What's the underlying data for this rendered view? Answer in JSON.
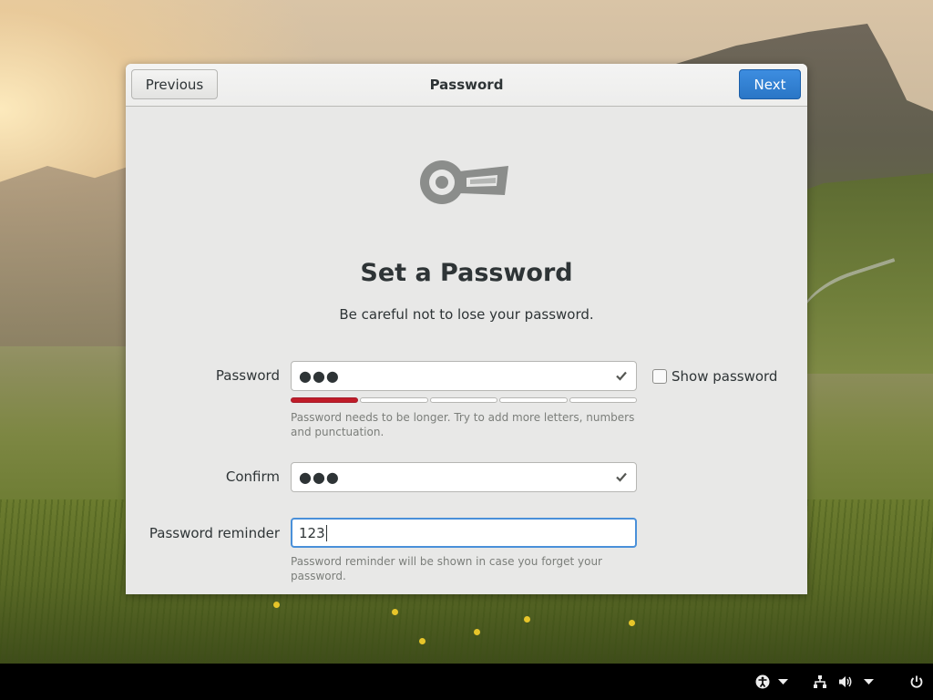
{
  "header": {
    "title": "Password",
    "previous_label": "Previous",
    "next_label": "Next"
  },
  "main": {
    "heading": "Set a Password",
    "subtitle": "Be careful not to lose your password.",
    "password": {
      "label": "Password",
      "masked_value": "●●●",
      "strength_hint": "Password needs to be longer. Try to add more letters, numbers and punctuation.",
      "strength_level": 0.2
    },
    "show_password": {
      "label": "Show password",
      "checked": false
    },
    "confirm": {
      "label": "Confirm",
      "masked_value": "●●●"
    },
    "reminder": {
      "label": "Password reminder",
      "value": "123",
      "hint": "Password reminder will be shown in case you forget your password."
    }
  },
  "icons": {
    "hero": "key-icon",
    "valid": "checkmark-icon",
    "tray": [
      "accessibility-icon",
      "chevron-down-icon",
      "network-icon",
      "volume-icon",
      "chevron-down-icon",
      "power-icon"
    ]
  },
  "colors": {
    "accent": "#3584e4",
    "strength_weak": "#c01c28"
  }
}
